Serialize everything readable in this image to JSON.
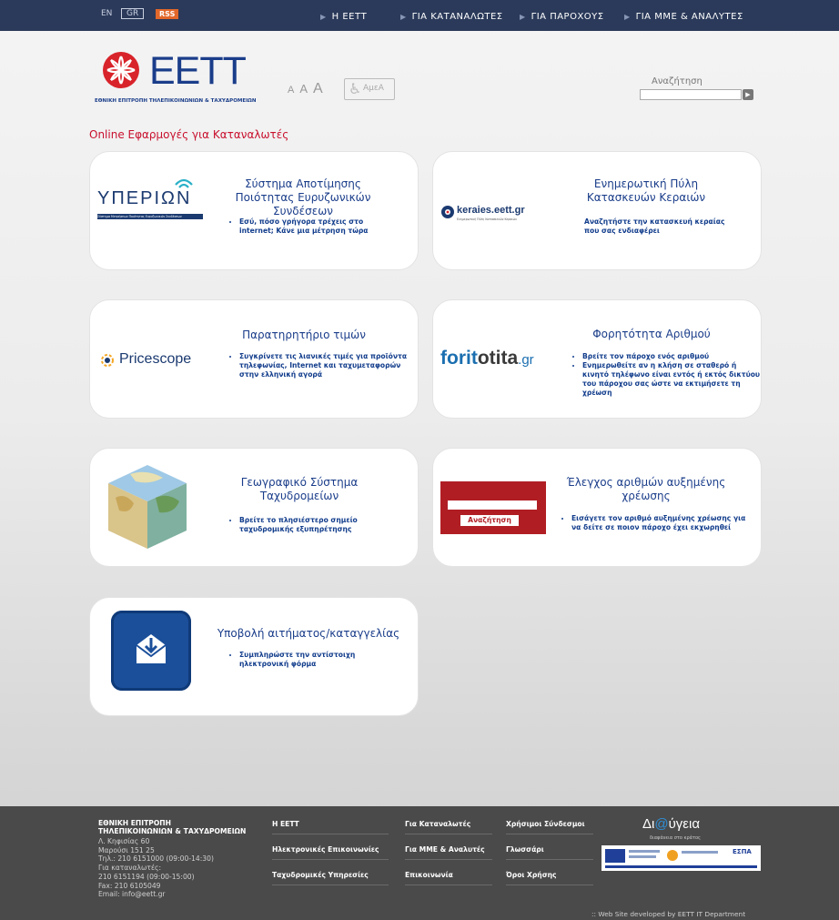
{
  "topbar": {
    "langs": [
      "EN",
      "GR"
    ],
    "rss": "RSS",
    "nav": [
      "Η ΕΕΤΤ",
      "ΓΙΑ ΚΑΤΑΝΑΛΩΤΕΣ",
      "ΓΙΑ ΠΑΡΟΧΟΥΣ",
      "ΓΙΑ ΜΜΕ & ΑΝΑΛΥΤΕΣ"
    ]
  },
  "header": {
    "logo_text": "EETT",
    "logo_sub": "ΕΘΝΙΚΗ ΕΠΙΤΡΟΠΗ ΤΗΛΕΠΙΚΟΙΝΩΝΙΩΝ & ΤΑΧΥΔΡΟΜΕΙΩΝ",
    "font_sizes": [
      "A",
      "A",
      "A"
    ],
    "amea": "ΑμεΑ",
    "search_label": "Αναζήτηση"
  },
  "section_title": "Online Εφαρμογές για Καταναλωτές",
  "cards": [
    {
      "logo_text": "ΥΠΕΡΙΩΝ",
      "logo_sub": "Σύστημα Μετρήσεων Ποιότητας Ευρυζωνικών Συνδέσεων",
      "title": "Σύστημα Αποτίμησης Ποιότητας Ευρυζωνικών Συνδέσεων",
      "bullets": [
        "Εσύ, πόσο γρήγορα τρέχεις στο internet; Κάνε μια μέτρηση τώρα"
      ]
    },
    {
      "logo_text": "keraies.eett.gr",
      "logo_sub": "Ενημερωτική Πύλη Κατασκευών Κεραιών",
      "title": "Ενημερωτική Πύλη Κατασκευών Κεραιών",
      "desc": "Αναζητήστε την κατασκευή κεραίας που σας ενδιαφέρει"
    },
    {
      "logo_text": "Pricescope",
      "title": "Παρατηρητήριο τιμών",
      "bullets": [
        "Συγκρίνετε τις λιανικές τιμές για προϊόντα τηλεφωνίας, Internet και ταχυμεταφορών στην ελληνική αγορά"
      ]
    },
    {
      "logo_text_a": "forit",
      "logo_text_b": "o",
      "logo_text_c": "tita",
      "logo_text_d": ".gr",
      "title": "Φορητότητα Αριθμού",
      "bullets": [
        "Βρείτε τον πάροχο ενός αριθμού",
        "Ενημερωθείτε αν η κλήση σε σταθερό ή κινητό τηλέφωνο είναι εντός ή εκτός δικτύου του πάροχου σας ώστε να εκτιμήσετε τη χρέωση"
      ]
    },
    {
      "title": "Γεωγραφικό Σύστημα Ταχυδρομείων",
      "bullets": [
        "Βρείτε το πλησιέστερο σημείο ταχυδρομικής εξυπηρέτησης"
      ]
    },
    {
      "search_button": "Αναζήτηση",
      "title": "Έλεγχος αριθμών αυξημένης χρέωσης",
      "bullets": [
        "Εισάγετε τον αριθμό αυξημένης χρέωσης για να δείτε σε ποιον πάροχο έχει εκχωρηθεί"
      ]
    },
    {
      "title": "Υποβολή αιτήματος/καταγγελίας",
      "bullets": [
        "Συμπληρώστε την αντίστοιχη ηλεκτρονική φόρμα"
      ]
    }
  ],
  "footer": {
    "org_line1": "ΕΘΝΙΚΗ ΕΠΙΤΡΟΠΗ",
    "org_line2": "ΤΗΛΕΠΙΚΟΙΝΩΝΙΩΝ & ΤΑΧΥΔΡΟΜΕΙΩΝ",
    "address": [
      "Λ. Κηφισίας 60",
      "Μαρούσι 151 25",
      "Τηλ.: 210 6151000 (09:00-14:30)",
      "Για καταναλωτές:",
      "210 6151194 (09:00-15:00)",
      "Fax: 210 6105049",
      "Email: info@eett.gr"
    ],
    "col1": [
      "Η ΕΕΤΤ",
      "Ηλεκτρονικές Επικοινωνίες",
      "Ταχυδρομικές Υπηρεσίες"
    ],
    "col2": [
      "Για Καταναλωτές",
      "Για ΜΜΕ & Αναλυτές",
      "Επικοινωνία"
    ],
    "col3": [
      "Χρήσιμοι Σύνδεσμοι",
      "Γλωσσάρι",
      "Όροι Χρήσης"
    ],
    "diavgeia_a": "Δι",
    "diavgeia_b": "@",
    "diavgeia_c": "ύγεια",
    "diavgeia_sub": "διαφάνεια στο κράτος",
    "espa": "ΕΣΠΑ",
    "credit": ":: Web Site developed by EETT IT Department"
  }
}
